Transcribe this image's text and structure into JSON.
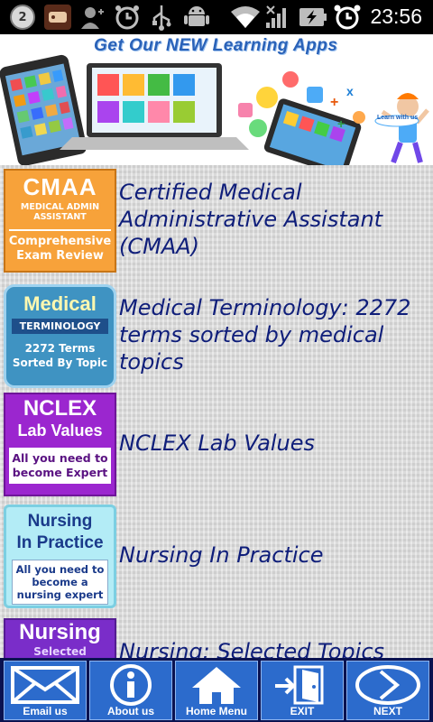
{
  "status_bar": {
    "notification_count": "2",
    "time": "23:56",
    "icons": [
      "notification-badge-icon",
      "app-icon",
      "add-user-icon",
      "alarm-icon",
      "usb-icon",
      "android-icon",
      "wifi-icon",
      "signal-icon",
      "battery-charging-icon",
      "alarm-clock-icon"
    ]
  },
  "banner": {
    "title": "Get Our NEW Learning Apps",
    "tag": "Learn with us"
  },
  "apps": [
    {
      "title": "Certified Medical Administrative Assistant (CMAA)",
      "thumb": {
        "big": "CMAA",
        "small": "MEDICAL ADMIN ASSISTANT",
        "sub1": "Comprehensive",
        "sub2": "Exam Review"
      }
    },
    {
      "title": "Medical Terminology: 2272 terms sorted by medical topics",
      "thumb": {
        "big": "Medical",
        "band": "TERMINOLOGY",
        "sub1": "2272 Terms",
        "sub2": "Sorted By Topic"
      }
    },
    {
      "title": "NCLEX Lab Values",
      "thumb": {
        "big": "NCLEX",
        "mid": "Lab Values",
        "sub1": "All you need to",
        "sub2": "become Expert"
      }
    },
    {
      "title": "Nursing In Practice",
      "thumb": {
        "big1": "Nursing",
        "big2": "In Practice",
        "sub1": "All you need to",
        "sub2": "become a",
        "sub3": "nursing expert"
      }
    },
    {
      "title": "Nursing: Selected Topics",
      "thumb": {
        "big": "Nursing",
        "small": "Selected"
      }
    }
  ],
  "bottom_nav": [
    {
      "label": "Email us",
      "icon": "envelope-icon"
    },
    {
      "label": "About us",
      "icon": "info-icon"
    },
    {
      "label": "Home Menu",
      "icon": "home-icon"
    },
    {
      "label": "EXIT",
      "icon": "exit-door-icon"
    },
    {
      "label": "NEXT",
      "icon": "next-arrow-icon"
    }
  ],
  "colors": {
    "title_text": "#0f1e7a",
    "nav_button": "#2c6bcc",
    "nav_background": "#0a1250",
    "banner_title": "#2a62b8"
  }
}
